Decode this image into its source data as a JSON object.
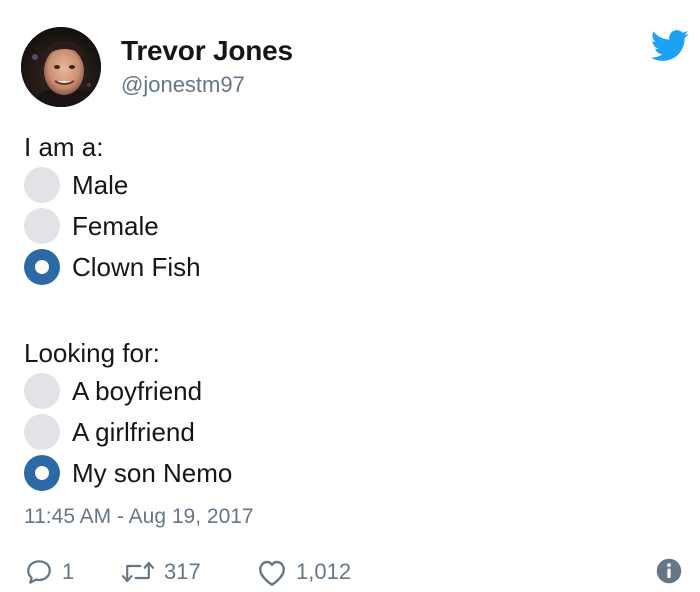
{
  "author": {
    "name": "Trevor Jones",
    "handle": "@jonestm97"
  },
  "logo_icon": "twitter-bird-icon",
  "sections": [
    {
      "label": "I am a:",
      "options": [
        {
          "label": "Male",
          "checked": false
        },
        {
          "label": "Female",
          "checked": false
        },
        {
          "label": "Clown Fish",
          "checked": true
        }
      ]
    },
    {
      "label": "Looking for:",
      "options": [
        {
          "label": "A boyfriend",
          "checked": false
        },
        {
          "label": "A girlfriend",
          "checked": false
        },
        {
          "label": "My son Nemo",
          "checked": true
        }
      ]
    }
  ],
  "timestamp": "11:45 AM - Aug 19, 2017",
  "actions": {
    "reply_count": "1",
    "retweet_count": "317",
    "like_count": "1,012"
  },
  "colors": {
    "twitter_blue": "#1da1f2",
    "radio_checked": "#2b6aa6",
    "radio_unchecked": "#e1e3e6",
    "secondary_text": "#657786"
  }
}
